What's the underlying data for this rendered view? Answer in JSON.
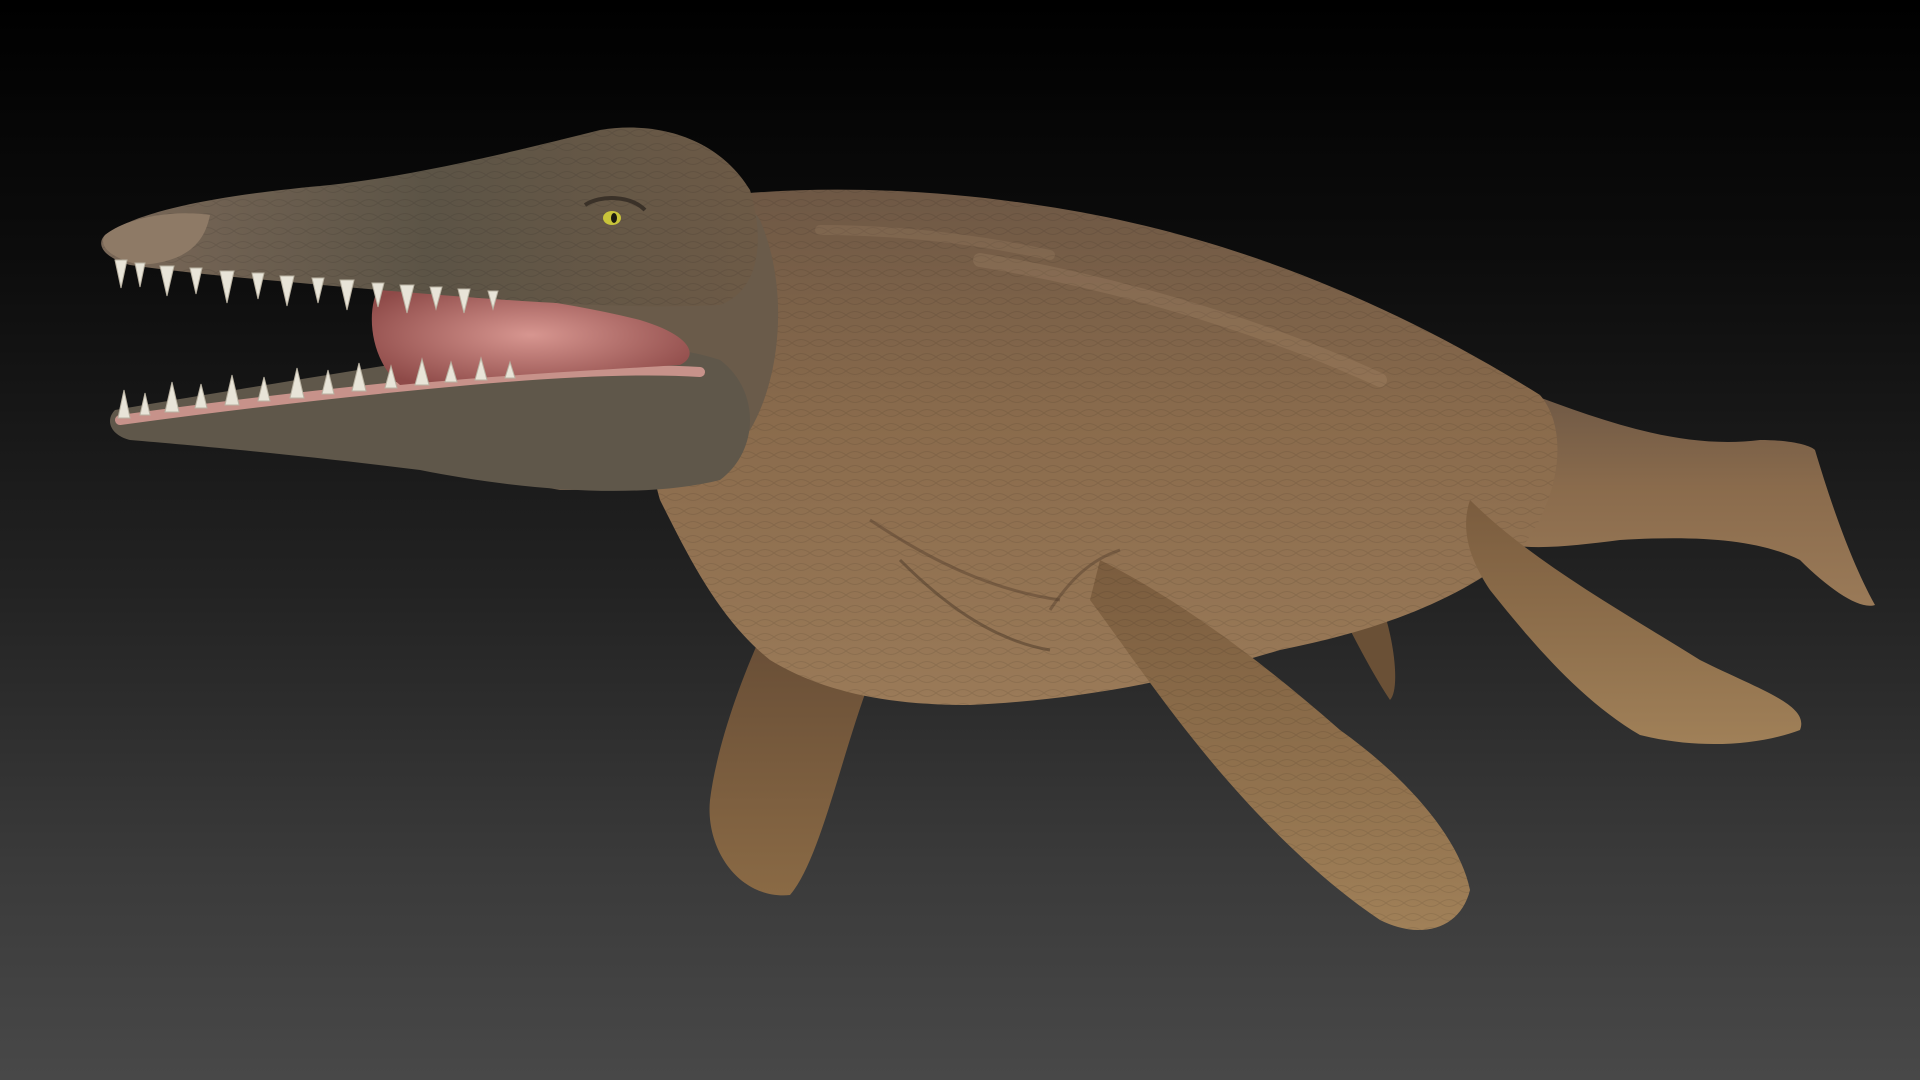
{
  "scene": {
    "subject_icon": "pliosaur-icon",
    "colors": {
      "background_top": "#000000",
      "background_bottom": "#484848",
      "skin_base": "#7a5e42",
      "skin_light": "#9a7b58",
      "skin_dark": "#4e3a29",
      "head_tone": "#5f5647",
      "mouth_inner": "#b86f6c",
      "gum": "#c98a86",
      "teeth": "#e8e4d8",
      "eye": "#c9c43a"
    }
  }
}
